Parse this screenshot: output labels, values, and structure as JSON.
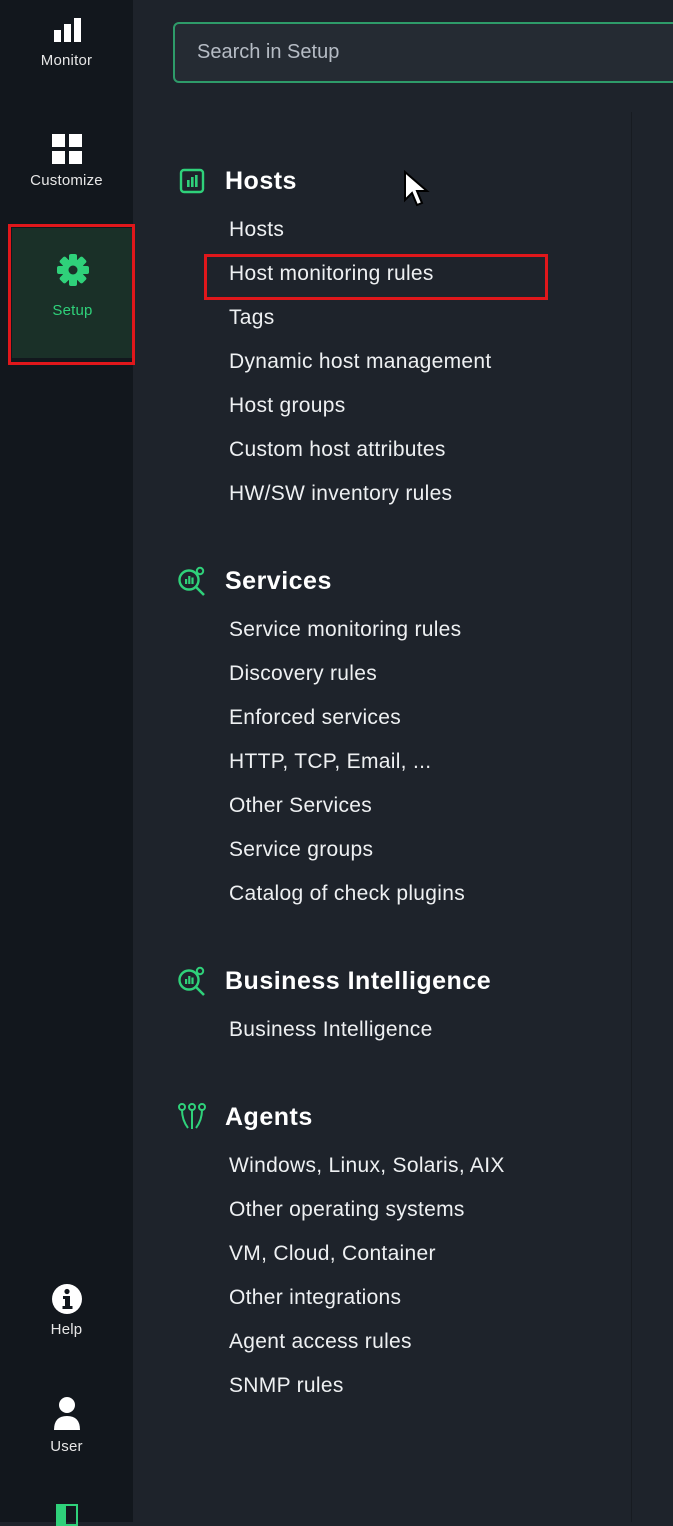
{
  "rail": {
    "items": [
      {
        "label": "Monitor",
        "icon": "monitor-icon"
      },
      {
        "label": "Customize",
        "icon": "customize-icon"
      },
      {
        "label": "Setup",
        "icon": "gear-icon",
        "active": true
      },
      {
        "label": "Help",
        "icon": "info-icon"
      },
      {
        "label": "User",
        "icon": "user-icon"
      }
    ],
    "bottom_icon": "sidebar-toggle-icon"
  },
  "search": {
    "placeholder": "Search in Setup"
  },
  "sections": [
    {
      "title": "Hosts",
      "icon": "hosts-icon",
      "links": [
        "Hosts",
        "Host monitoring rules",
        "Tags",
        "Dynamic host management",
        "Host groups",
        "Custom host attributes",
        "HW/SW inventory rules"
      ]
    },
    {
      "title": "Services",
      "icon": "services-icon",
      "links": [
        "Service monitoring rules",
        "Discovery rules",
        "Enforced services",
        "HTTP, TCP, Email, ...",
        "Other Services",
        "Service groups",
        "Catalog of check plugins"
      ]
    },
    {
      "title": "Business Intelligence",
      "icon": "bi-icon",
      "links": [
        "Business Intelligence"
      ]
    },
    {
      "title": "Agents",
      "icon": "agents-icon",
      "links": [
        "Windows, Linux, Solaris, AIX",
        "Other operating systems",
        "VM, Cloud, Container",
        "Other integrations",
        "Agent access rules",
        "SNMP rules"
      ]
    }
  ],
  "colors": {
    "accent": "#2fd17a",
    "highlight": "#e0171b",
    "background": "#1e232b",
    "rail": "#12171d"
  }
}
